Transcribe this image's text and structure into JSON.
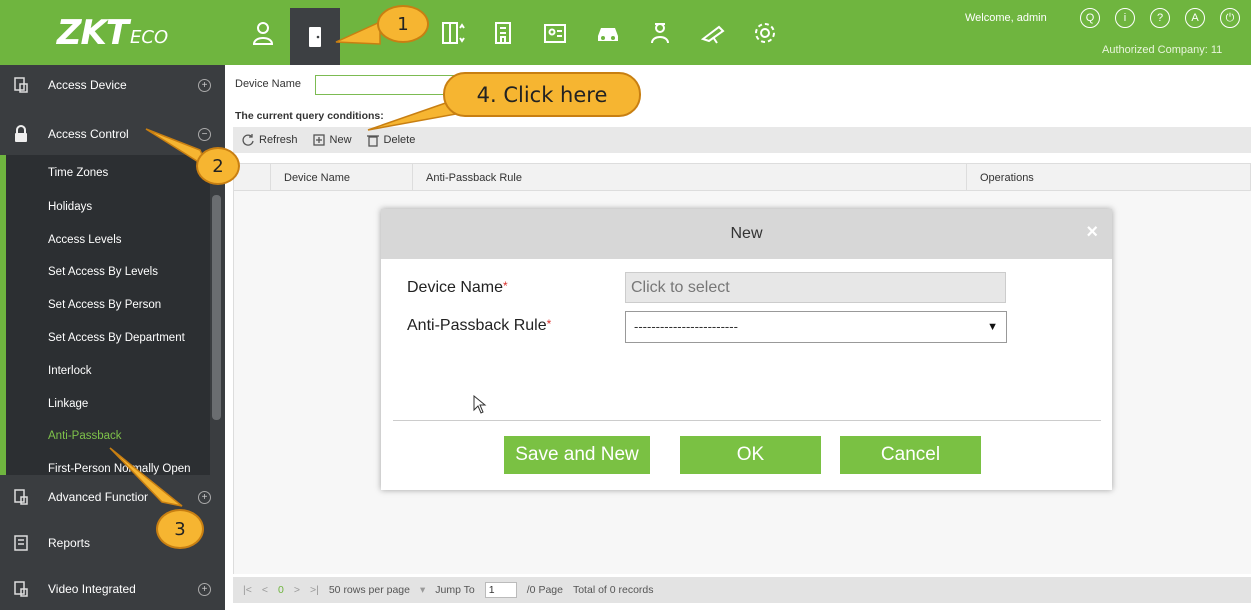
{
  "app": {
    "logo_main": "ZKT",
    "logo_suffix": "ECO",
    "welcome": "Welcome, admin",
    "company": "Authorized Company: 11",
    "top_icons": [
      "person-icon",
      "door-icon",
      "elevator-icon",
      "building-icon",
      "id-card-icon",
      "car-icon",
      "guard-icon",
      "camera-icon",
      "gear-icon"
    ],
    "right_icons": [
      "user-circle-icon",
      "info-icon",
      "help-icon",
      "account-icon",
      "power-icon"
    ]
  },
  "sidebar": {
    "sections": [
      {
        "label": "Access Device",
        "icon": "device-icon",
        "toggle": "+"
      },
      {
        "label": "Access Control",
        "icon": "lock-icon",
        "toggle": "−"
      },
      {
        "label": "Advanced Functions",
        "icon": "advanced-icon",
        "toggle": "+"
      },
      {
        "label": "Reports",
        "icon": "report-icon",
        "toggle": ""
      },
      {
        "label": "Video Integrated",
        "icon": "video-icon",
        "toggle": "+"
      }
    ],
    "items": [
      {
        "label": "Time Zones"
      },
      {
        "label": "Holidays"
      },
      {
        "label": "Access Levels"
      },
      {
        "label": "Set Access By Levels"
      },
      {
        "label": "Set Access By Person"
      },
      {
        "label": "Set Access By Department"
      },
      {
        "label": "Interlock"
      },
      {
        "label": "Linkage"
      },
      {
        "label": "Anti-Passback"
      },
      {
        "label": "First-Person Normally Open"
      }
    ]
  },
  "query": {
    "device_name_label": "Device Name",
    "device_name_value": "",
    "conditions_label": "The current query conditions:"
  },
  "toolbar": {
    "refresh": "Refresh",
    "new": "New",
    "delete": "Delete"
  },
  "grid": {
    "columns": [
      "Device Name",
      "Anti-Passback Rule",
      "Operations"
    ]
  },
  "pager": {
    "current_page": "0",
    "rows_per_page": "50 rows per page",
    "jump_to_label": "Jump To",
    "jump_value": "1",
    "page_total": "/0 Page",
    "records": "Total of 0 records"
  },
  "modal": {
    "title": "New",
    "close": "×",
    "device_name_label": "Device Name",
    "device_name_placeholder": "Click to select",
    "rule_label": "Anti-Passback Rule",
    "rule_value": "------------------------",
    "required_mark": "*",
    "save_and_new": "Save and New",
    "ok": "OK",
    "cancel": "Cancel"
  },
  "callouts": {
    "one": "1",
    "two": "2",
    "three": "3",
    "four": "4. Click here"
  },
  "colors": {
    "brand_green": "#6fb53f",
    "button_green": "#7ac143",
    "sidebar_bg": "#3a3d40",
    "callout_orange": "#f6b531"
  }
}
